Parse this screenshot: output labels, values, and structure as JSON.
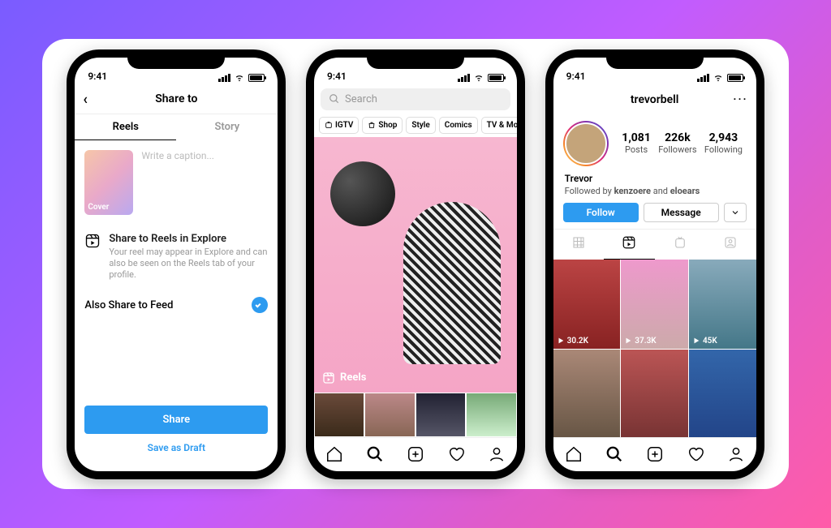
{
  "status_time": "9:41",
  "phone1": {
    "title": "Share to",
    "tab_reels": "Reels",
    "tab_story": "Story",
    "cover_label": "Cover",
    "caption_placeholder": "Write a caption...",
    "share_explore_title": "Share to Reels in Explore",
    "share_explore_desc": "Your reel may appear in Explore and can also be seen on the Reels tab of your profile.",
    "also_feed": "Also Share to Feed",
    "share_btn": "Share",
    "draft_btn": "Save as Draft"
  },
  "phone2": {
    "search_placeholder": "Search",
    "chips": [
      "IGTV",
      "Shop",
      "Style",
      "Comics",
      "TV & Movie"
    ],
    "reels_label": "Reels"
  },
  "phone3": {
    "username": "trevorbell",
    "display_name": "Trevor",
    "stats": {
      "posts_n": "1,081",
      "posts_l": "Posts",
      "followers_n": "226k",
      "followers_l": "Followers",
      "following_n": "2,943",
      "following_l": "Following"
    },
    "followed_by_prefix": "Followed by ",
    "followed_by_1": "kenzoere",
    "followed_by_mid": " and ",
    "followed_by_2": "eloears",
    "follow_btn": "Follow",
    "message_btn": "Message",
    "reel_views": [
      "30.2K",
      "37.3K",
      "45K"
    ]
  }
}
